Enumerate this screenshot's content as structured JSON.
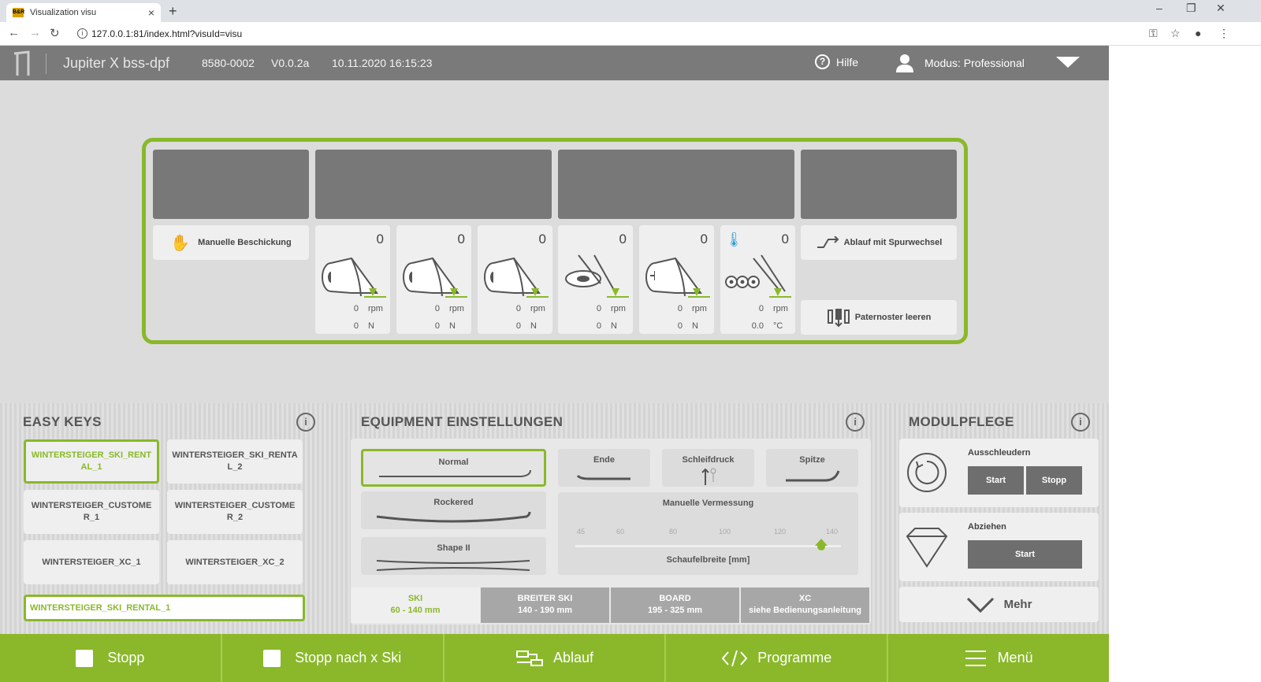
{
  "browser": {
    "tab_title": "Visualization visu",
    "favicon_text": "B&R",
    "url": "127.0.0.1:81/index.html?visuId=visu"
  },
  "header": {
    "title": "Jupiter X bss-dpf",
    "serial": "8580-0002",
    "version": "V0.0.2a",
    "datetime": "10.11.2020 16:15:23",
    "help_label": "Hilfe",
    "mode_label": "Modus: Professional"
  },
  "machine": {
    "manual_load_label": "Manuelle Beschickung",
    "track_change_label": "Ablauf mit Spurwechsel",
    "paternoster_label": "Paternoster leeren",
    "stations": [
      {
        "count": "0",
        "v1": "0",
        "u1": "rpm",
        "v2": "0",
        "u2": "N"
      },
      {
        "count": "0",
        "v1": "0",
        "u1": "rpm",
        "v2": "0",
        "u2": "N"
      },
      {
        "count": "0",
        "v1": "0",
        "u1": "rpm",
        "v2": "0",
        "u2": "N"
      },
      {
        "count": "0",
        "v1": "0",
        "u1": "rpm",
        "v2": "0",
        "u2": "N"
      },
      {
        "count": "0",
        "v1": "0",
        "u1": "rpm",
        "v2": "0",
        "u2": "N"
      },
      {
        "count": "0",
        "v1": "0",
        "u1": "rpm",
        "v2": "0.0",
        "u2": "°C"
      }
    ]
  },
  "easy_keys": {
    "title": "EASY KEYS",
    "keys": [
      "WINTERSTEIGER_SKI_RENTAL_1",
      "WINTERSTEIGER_SKI_RENTAL_2",
      "WINTERSTEIGER_CUSTOMER_1",
      "WINTERSTEIGER_CUSTOMER_2",
      "WINTERSTEIGER_XC_1",
      "WINTERSTEIGER_XC_2"
    ],
    "selected": "WINTERSTEIGER_SKI_RENTAL_1"
  },
  "equipment": {
    "title": "EQUIPMENT EINSTELLUNGEN",
    "normal": "Normal",
    "rockered": "Rockered",
    "shape": "Shape II",
    "ende": "Ende",
    "schleifdruck": "Schleifdruck",
    "spitze": "Spitze",
    "vermessung": "Manuelle Vermessung",
    "slider_ticks": [
      "45",
      "60",
      "80",
      "100",
      "120",
      "140"
    ],
    "slider_value": 133,
    "slider_label": "Schaufelbreite [mm]",
    "tabs": [
      {
        "name": "SKI",
        "range": "60 - 140 mm"
      },
      {
        "name": "BREITER SKI",
        "range": "140 - 190 mm"
      },
      {
        "name": "BOARD",
        "range": "195 - 325 mm"
      },
      {
        "name": "XC",
        "range": "siehe Bedienungsanleitung"
      }
    ]
  },
  "modulpflege": {
    "title": "MODULPFLEGE",
    "ausschleudern": "Ausschleudern",
    "start": "Start",
    "stopp": "Stopp",
    "abziehen": "Abziehen",
    "abziehen_start": "Start",
    "mehr": "Mehr"
  },
  "footer": {
    "stopp": "Stopp",
    "stopp_nach": "Stopp nach x Ski",
    "ablauf": "Ablauf",
    "programme": "Programme",
    "menu": "Menü"
  },
  "colors": {
    "accent": "#8ab82a",
    "header": "#7a7a7a",
    "block": "#787878"
  }
}
